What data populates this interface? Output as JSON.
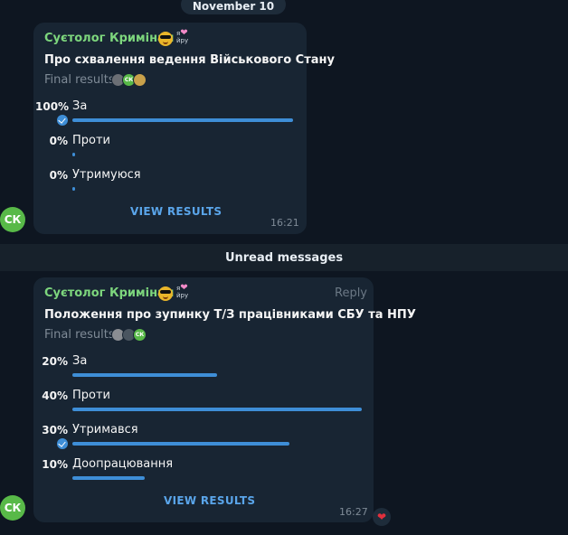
{
  "date_separator": "November 10",
  "unread_label": "Unread messages",
  "avatar_initials": "СК",
  "messages": [
    {
      "sender": "Суєтолог Кримінал",
      "sender_tag_top": "я",
      "sender_tag_bottom": "йру",
      "question": "Про схвалення  ведення Військового Стану",
      "final_results": "Final results",
      "options": [
        {
          "percent": "100%",
          "label": "За",
          "fraction": 1.0,
          "voted": true
        },
        {
          "percent": "0%",
          "label": "Проти",
          "fraction": 0.0,
          "voted": false
        },
        {
          "percent": "0%",
          "label": "Утримуюся",
          "fraction": 0.0,
          "voted": false
        }
      ],
      "view_results": "VIEW RESULTS",
      "time": "16:21",
      "voter_badge": "СК"
    },
    {
      "sender": "Суєтолог Кримінал",
      "sender_tag_top": "я",
      "sender_tag_bottom": "йру",
      "reply_label": "Reply",
      "question": "Положення про зупинку Т/З працівниками СБУ та НПУ",
      "final_results": "Final results",
      "options": [
        {
          "percent": "20%",
          "label": "За",
          "fraction": 0.2,
          "voted": false
        },
        {
          "percent": "40%",
          "label": "Проти",
          "fraction": 0.4,
          "voted": false
        },
        {
          "percent": "30%",
          "label": "Утримався",
          "fraction": 0.3,
          "voted": true
        },
        {
          "percent": "10%",
          "label": "Доопрацювання",
          "fraction": 0.1,
          "voted": false
        }
      ],
      "view_results": "VIEW RESULTS",
      "time": "16:27",
      "voter_badge": "СК"
    }
  ],
  "colors": {
    "accent": "#3e8ed7",
    "sender": "#7dd67d",
    "bubble": "#182533",
    "background": "#0e1621",
    "reaction": "#e2303d"
  },
  "icons": {
    "voted": "check-circle-icon",
    "reaction": "heart-icon",
    "sender_emoji": "sunglasses-emoji-icon"
  }
}
